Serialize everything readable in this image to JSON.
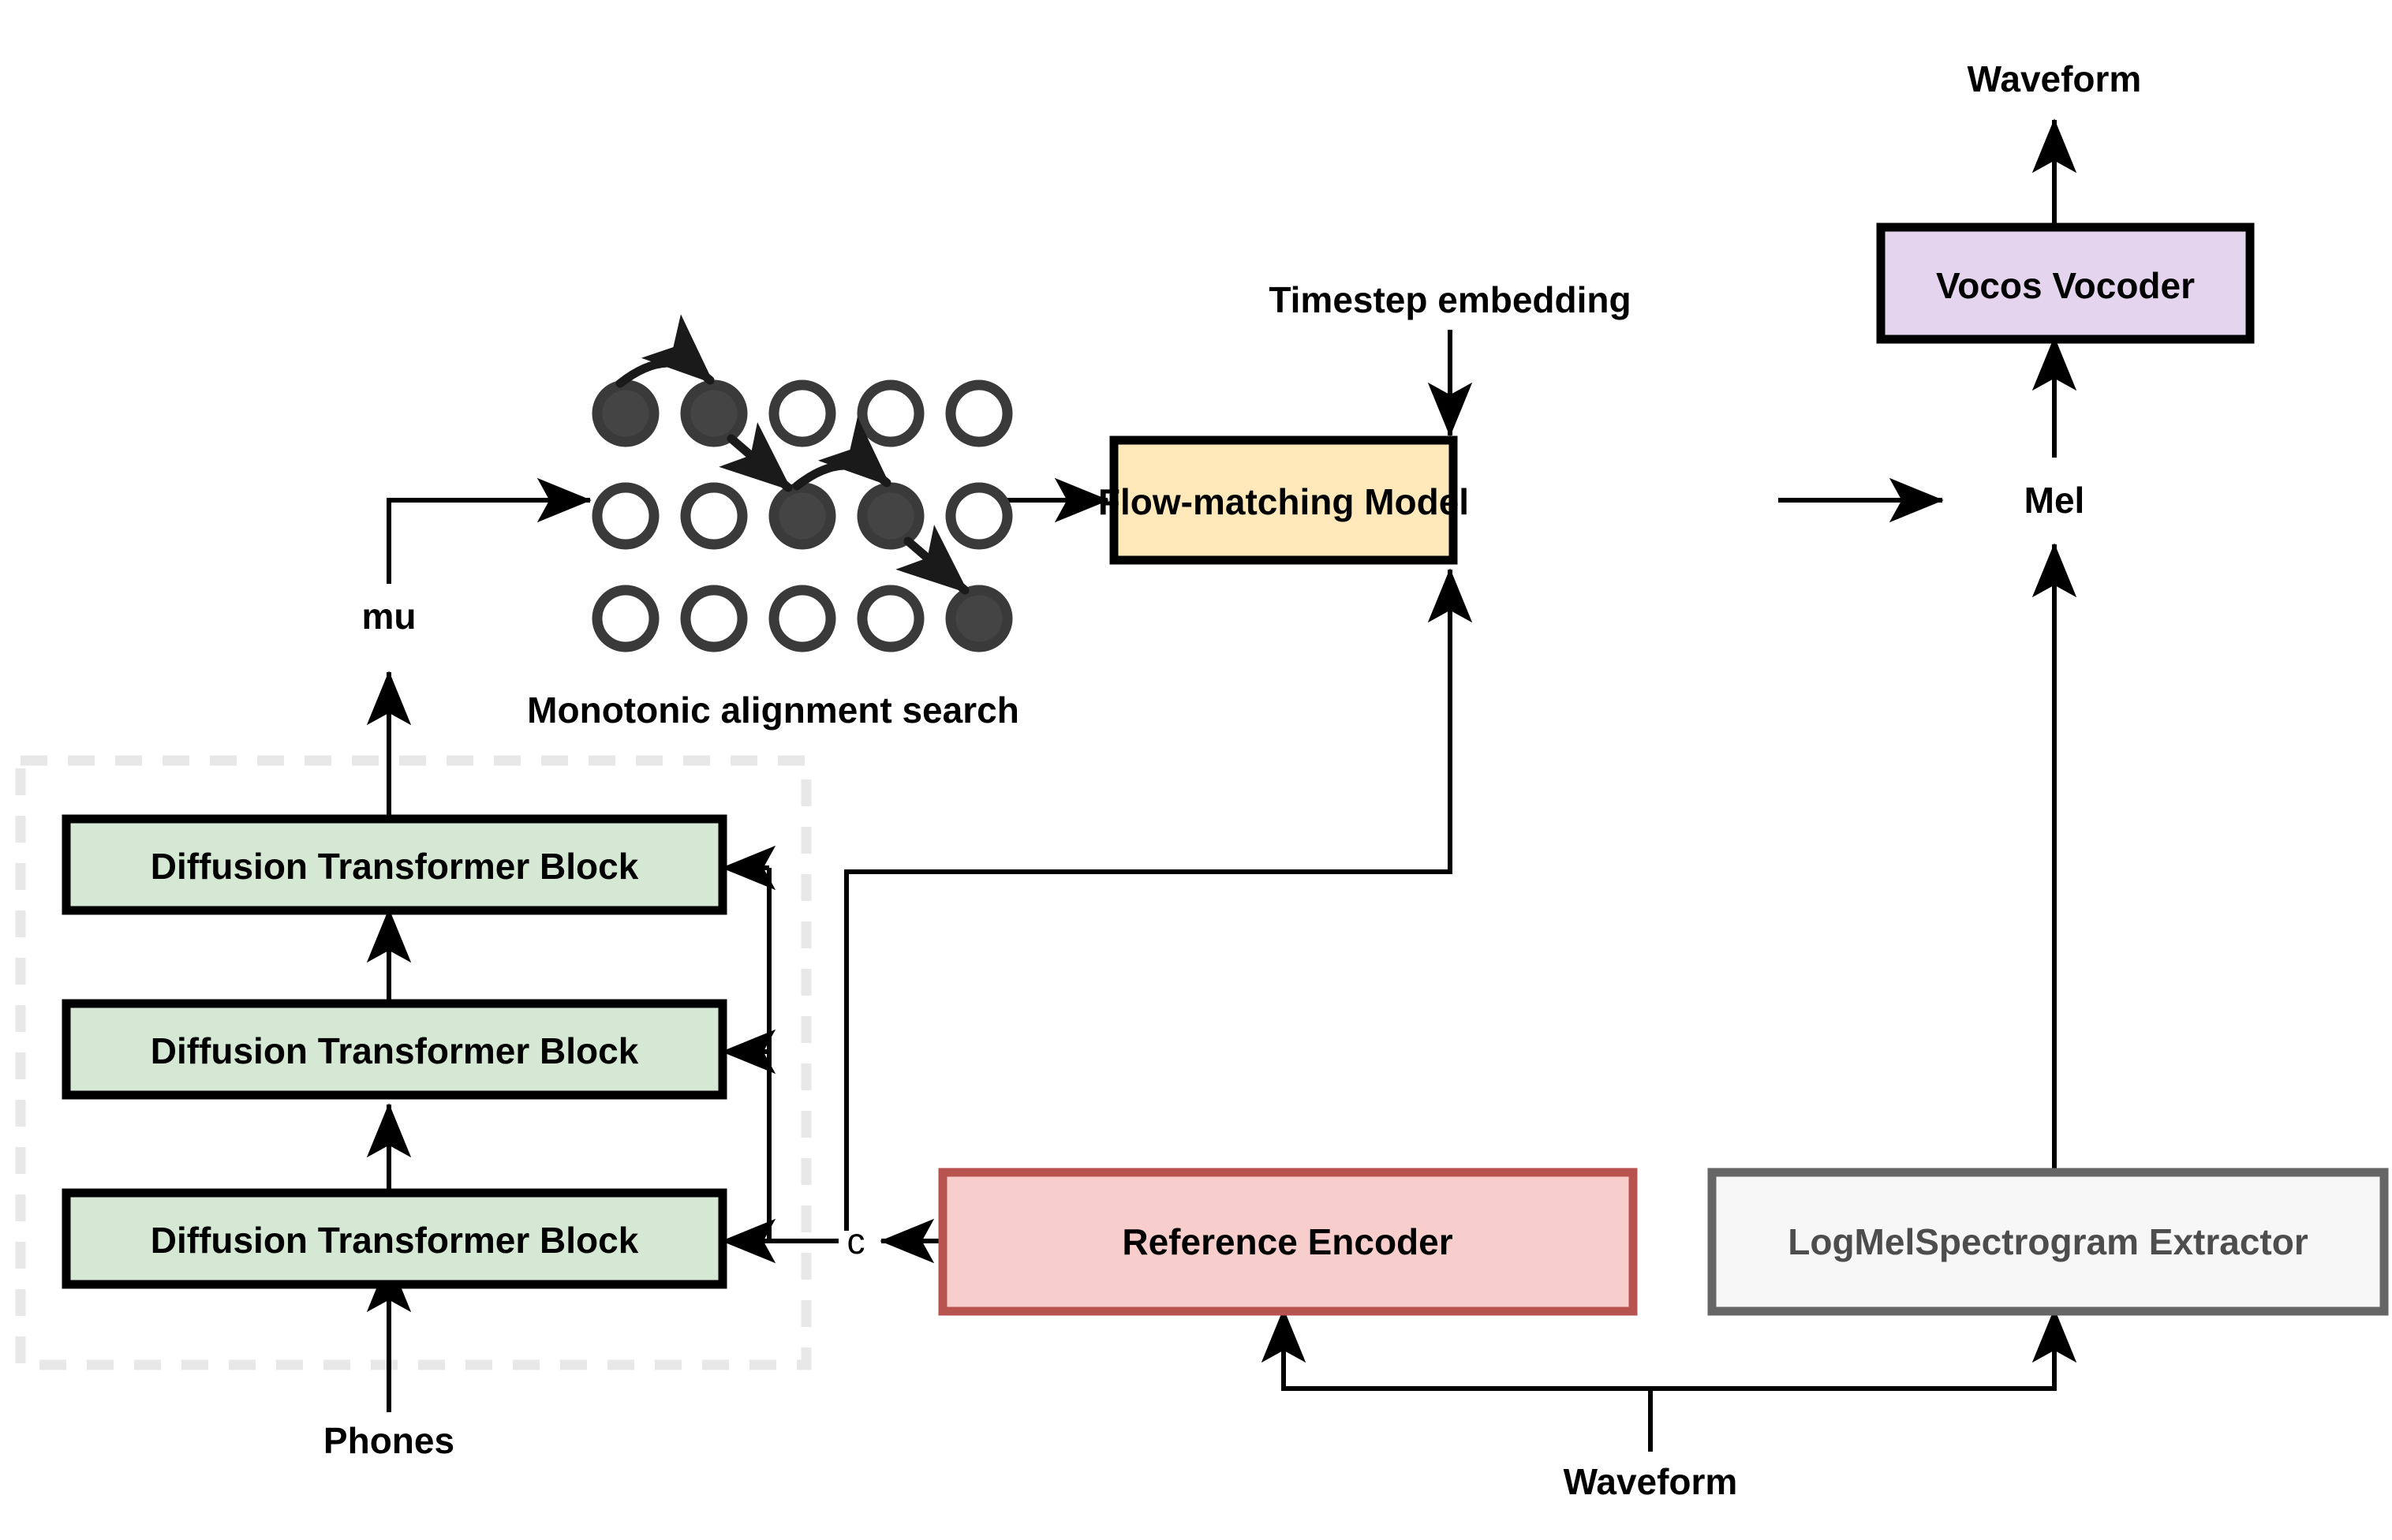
{
  "diagram": {
    "title": "TTS flow-matching architecture diagram",
    "background": "#ffffff"
  },
  "colors": {
    "diffusion_block_fill": "#d5e8d4",
    "diffusion_block_stroke": "#000000",
    "flow_model_fill": "#ffe9bb",
    "flow_model_stroke": "#000000",
    "vocoder_fill": "#e5d4ee",
    "vocoder_stroke": "#000000",
    "reference_encoder_fill": "#f8cecc",
    "reference_encoder_stroke": "#b85450",
    "logmel_fill": "#f7f7f7",
    "logmel_stroke": "#666666",
    "logmel_text": "#4d4d4d",
    "dashed_group_stroke": "#e8e8e8",
    "node_outline": "#3a3a3a",
    "node_fill_active": "#444444",
    "node_fill_inactive": "#ffffff",
    "edge": "#000000"
  },
  "boxes": {
    "diffusion_block_top": {
      "label": "Diffusion Transformer Block"
    },
    "diffusion_block_mid": {
      "label": "Diffusion Transformer Block"
    },
    "diffusion_block_bottom": {
      "label": "Diffusion Transformer Block"
    },
    "flow_matching_model": {
      "label": "Flow-matching Model"
    },
    "vocos_vocoder": {
      "label": "Vocos Vocoder"
    },
    "reference_encoder": {
      "label": "Reference Encoder"
    },
    "logmel_extractor": {
      "label": "LogMelSpectrogram Extractor"
    }
  },
  "labels": {
    "waveform_output": "Waveform",
    "waveform_input": "Waveform",
    "timestep_embedding": "Timestep embedding",
    "mel": "Mel",
    "mu": "mu",
    "c": "c",
    "monotonic_alignment_search": "Monotonic alignment search",
    "phones": "Phones"
  },
  "alignment_grid": {
    "caption": "Monotonic alignment search",
    "rows": 3,
    "cols": 5,
    "active_cells": [
      [
        0,
        0
      ],
      [
        0,
        1
      ],
      [
        1,
        2
      ],
      [
        1,
        3
      ],
      [
        2,
        4
      ]
    ],
    "path_arrows": [
      {
        "from": [
          0,
          0
        ],
        "to": [
          0,
          1
        ],
        "style": "curved"
      },
      {
        "from": [
          0,
          1
        ],
        "to": [
          1,
          2
        ],
        "style": "straight"
      },
      {
        "from": [
          1,
          2
        ],
        "to": [
          1,
          3
        ],
        "style": "curved"
      },
      {
        "from": [
          1,
          3
        ],
        "to": [
          2,
          4
        ],
        "style": "straight"
      }
    ]
  },
  "edges": [
    {
      "from": "phones",
      "to": "diffusion_block_bottom",
      "label": ""
    },
    {
      "from": "diffusion_block_bottom",
      "to": "diffusion_block_mid",
      "label": ""
    },
    {
      "from": "diffusion_block_mid",
      "to": "diffusion_block_top",
      "label": ""
    },
    {
      "from": "diffusion_block_top",
      "to": "alignment_grid",
      "label": "mu"
    },
    {
      "from": "alignment_grid",
      "to": "flow_matching_model",
      "label": ""
    },
    {
      "from": "timestep_embedding",
      "to": "flow_matching_model",
      "label": ""
    },
    {
      "from": "flow_matching_model",
      "to": "mel",
      "label": ""
    },
    {
      "from": "mel",
      "to": "vocos_vocoder",
      "label": ""
    },
    {
      "from": "vocos_vocoder",
      "to": "waveform_output",
      "label": ""
    },
    {
      "from": "waveform_input",
      "to": "reference_encoder",
      "label": ""
    },
    {
      "from": "waveform_input",
      "to": "logmel_extractor",
      "label": ""
    },
    {
      "from": "logmel_extractor",
      "to": "mel",
      "label": ""
    },
    {
      "from": "reference_encoder",
      "to": "diffusion_block_top",
      "label": "c"
    },
    {
      "from": "reference_encoder",
      "to": "diffusion_block_mid",
      "label": "c"
    },
    {
      "from": "reference_encoder",
      "to": "diffusion_block_bottom",
      "label": "c"
    },
    {
      "from": "reference_encoder",
      "to": "flow_matching_model",
      "label": "c"
    }
  ]
}
